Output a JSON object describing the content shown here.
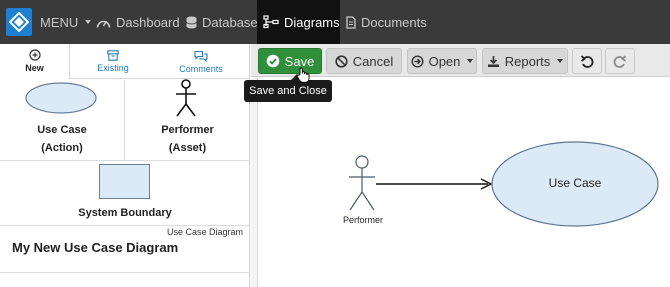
{
  "topnav": {
    "menu_label": "MENU",
    "items": [
      {
        "label": "Dashboard",
        "icon": "gauge-icon"
      },
      {
        "label": "Database",
        "icon": "database-icon"
      },
      {
        "label": "Diagrams",
        "icon": "diagram-icon",
        "active": true
      },
      {
        "label": "Documents",
        "icon": "document-icon"
      }
    ]
  },
  "left_panel": {
    "tabs": [
      {
        "label": "New",
        "icon": "plus-circle-icon",
        "active": true
      },
      {
        "label": "Existing",
        "icon": "archive-icon"
      },
      {
        "label": "Comments",
        "icon": "comments-icon"
      }
    ],
    "shapes": {
      "use_case": {
        "line1": "Use Case",
        "line2": "(Action)"
      },
      "performer": {
        "line1": "Performer",
        "line2": "(Asset)"
      },
      "system_boundary": {
        "label": "System Boundary"
      }
    },
    "diagram_type": "Use Case Diagram",
    "diagram_name": "My New Use Case Diagram"
  },
  "toolbar": {
    "save_label": "Save",
    "cancel_label": "Cancel",
    "open_label": "Open",
    "reports_label": "Reports",
    "tooltip": "Save and Close"
  },
  "canvas": {
    "use_case_label": "Use Case",
    "performer_label": "Performer"
  },
  "colors": {
    "nav_bg": "#3a3a3a",
    "active_nav_bg": "#111111",
    "logo_blue": "#1f7fd1",
    "save_green": "#2f8f3a",
    "use_case_fill": "#dceaf7",
    "link_blue": "#2a7ab0"
  }
}
